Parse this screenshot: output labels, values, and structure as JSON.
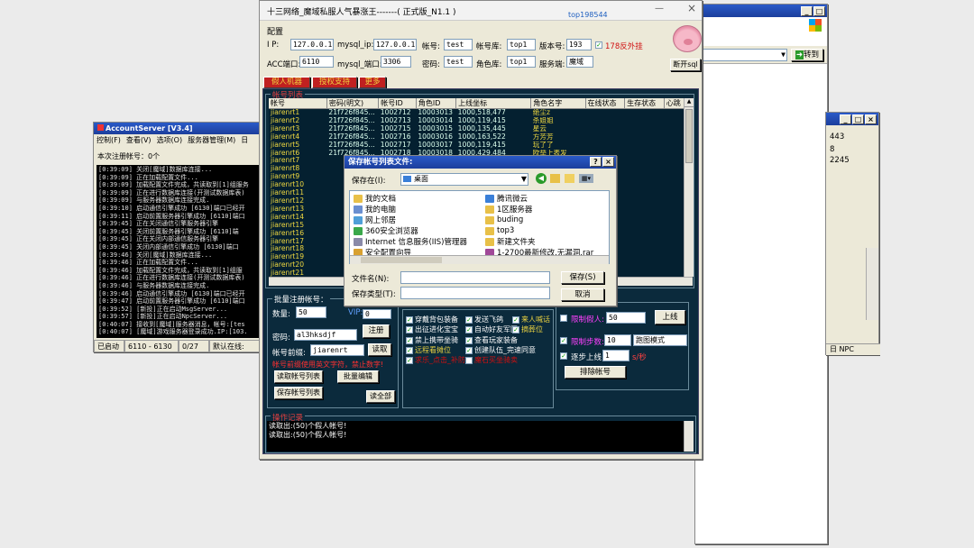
{
  "colors": {
    "desktop": "#ebebeb",
    "title_blue": "#1c3e9c",
    "dark_panel": "#0b2a3c",
    "gold": "#e8d040",
    "red": "#d01010",
    "cyan": "#5fd"
  },
  "account_server": {
    "title": "AccountServer [V3.4]",
    "menu": [
      "控制(F)",
      "查看(V)",
      "选项(O)",
      "服务器管理(M)",
      "日"
    ],
    "count": "本次注册帐号：0个",
    "log": [
      "[0:39:09] 关闭[魔域]数据库连接...",
      "[0:39:09] 正在加载配置文件...",
      "[0:39:09] 加载配置文件完成，共读取到[1]组服务",
      "[0:39:09] 正在进行数据库连接(开测试数据库表)",
      "[0:39:09] 与服务器数据库连接完成.",
      "[0:39:10] 启动通信引擎成功 [6130]端口已经开",
      "[0:39:11] 启动前置服务器引擎成功 [6110]端口",
      "[0:39:45] 正在关闭通信引擎服务器引擎",
      "[0:39:45] 关闭前置服务器引擎成功 [6110]端",
      "[0:39:45] 正在关闭内部通信服务器引擎",
      "[0:39:45] 关闭内部通信引擎成功 [6130]端口",
      "[0:39:46] 关闭[魔域]数据库连接...",
      "[0:39:46] 正在加载配置文件...",
      "[0:39:46] 加载配置文件完成，共读取到[1]组服",
      "[0:39:46] 正在进行数据库连接(开测试数据库表)",
      "[0:39:46] 与服务器数据库连接完成.",
      "[0:39:46] 启动通信引擎成功 [6130]端口已经开",
      "[0:39:47] 启动前置服务器引擎成功 [6110]端口",
      "[0:39:52] [新投]正在启动MsgServer...",
      "[0:39:57] [新投]正在启动NpcServer...",
      "[0:40:07] 接收到[魔域]服务器消息，帐号:[tes",
      "[0:40:07] [魔域]游戏服务器登录成功.IP:[103."
    ],
    "status": [
      "已启动",
      "6110 - 6130",
      "0/27",
      "默认在线:"
    ]
  },
  "right_window": {
    "address_arrow": "转到",
    "stats": [
      "443",
      "8",
      "2245"
    ],
    "npc": "日 NPC"
  },
  "main": {
    "title": "十三网络_魔域私服人气暴涨王-------( 正式版_N1.1 )",
    "watermark": "top198544",
    "config_title": "配置",
    "labels": {
      "ip": "I  P:",
      "mysql_ip": "mysql_ip:",
      "account": "帐号:",
      "account_db": "帐号库:",
      "version": "版本号:",
      "acc_port": "ACC端口:",
      "mysql_port": "mysql_端口:",
      "password": "密码:",
      "role_db": "角色库:",
      "server": "服务端:"
    },
    "values": {
      "ip": "127.0.0.1",
      "mysql_ip": "127.0.0.1",
      "account": "test",
      "account_db": "top1",
      "version": "193",
      "acc_port": "6110",
      "mysql_port": "3306",
      "password": "test",
      "role_db": "top1",
      "server": "魔域"
    },
    "anti_cheat": "178反外挂",
    "disconnect": "断开sql",
    "tabs": [
      "假人机器",
      "授权支持",
      "更多"
    ],
    "list_legend": "帐号列表",
    "columns": [
      "帐号",
      "密码(明文)",
      "帐号ID",
      "角色ID",
      "上线坐标",
      "角色名字",
      "在线状态",
      "生存状态",
      "心跳"
    ],
    "rows": [
      [
        "jiarenrt1",
        "21f726f845...",
        "1002712",
        "10003013",
        "1000,518,477",
        "绝尘z"
      ],
      [
        "jiarenrt2",
        "21f726f845...",
        "1002713",
        "10003014",
        "1000,119,415",
        "杀姐姐"
      ],
      [
        "jiarenrt3",
        "21f726f845...",
        "1002715",
        "10003015",
        "1000,135,445",
        "星云"
      ],
      [
        "jiarenrt4",
        "21f726f845...",
        "1002716",
        "10003016",
        "1000,163,522",
        "方芳芳"
      ],
      [
        "jiarenrt5",
        "21f726f845...",
        "1002717",
        "10003017",
        "1000,119,415",
        "玩了了"
      ],
      [
        "jiarenrt6",
        "21f726f845...",
        "1002718",
        "10003018",
        "1000,429,484",
        "欧举上表发"
      ],
      [
        "jiarenrt7",
        "",
        "",
        "",
        "",
        ""
      ],
      [
        "jiarenrt8",
        "",
        "",
        "",
        "",
        ""
      ],
      [
        "jiarenrt9",
        "",
        "",
        "",
        "",
        ""
      ],
      [
        "jiarenrt10",
        "",
        "",
        "",
        "",
        ""
      ],
      [
        "jiarenrt11",
        "",
        "",
        "",
        "",
        ""
      ],
      [
        "jiarenrt12",
        "",
        "",
        "",
        "",
        ""
      ],
      [
        "jiarenrt13",
        "",
        "",
        "",
        "",
        ""
      ],
      [
        "jiarenrt14",
        "",
        "",
        "",
        "",
        ""
      ],
      [
        "jiarenrt15",
        "",
        "",
        "",
        "",
        ""
      ],
      [
        "jiarenrt16",
        "",
        "",
        "",
        "",
        ""
      ],
      [
        "jiarenrt17",
        "",
        "",
        "",
        "",
        ""
      ],
      [
        "jiarenrt18",
        "",
        "",
        "",
        "",
        ""
      ],
      [
        "jiarenrt19",
        "",
        "",
        "",
        "",
        ""
      ],
      [
        "jiarenrt20",
        "",
        "",
        "",
        "",
        ""
      ],
      [
        "jiarenrt21",
        "",
        "",
        "",
        "",
        ""
      ]
    ],
    "batch": {
      "legend": "批量注册帐号：",
      "qty_label": "数量:",
      "qty": "50",
      "vip_label": "VIP:",
      "vip": "0",
      "pwd_label": "密码:",
      "pwd": "al3hksdjf",
      "register": "注册",
      "prefix_label": "帐号前缀:",
      "prefix": "jiarenrt",
      "read": "读取",
      "warn": "帐号前缀使用英文字符，禁止数字!",
      "read_list": "读取帐号列表",
      "batch_edit": "批量编辑",
      "save_list": "保存帐号列表",
      "read_all": "读全部"
    },
    "checks": [
      {
        "label": "穿戴背包装备",
        "c": "#ffffff",
        "on": true
      },
      {
        "label": "发送飞鸽",
        "c": "#ffffff",
        "on": true
      },
      {
        "label": "来人喊话",
        "c": "#e8d040",
        "on": true
      },
      {
        "label": "出征进化宝宝",
        "c": "#ffffff",
        "on": true
      },
      {
        "label": "自动好友军团",
        "c": "#ffffff",
        "on": true
      },
      {
        "label": "摘葬位",
        "c": "#e8d040",
        "on": true
      },
      {
        "label": "禁上携带坐骑",
        "c": "#ffffff",
        "on": true
      },
      {
        "label": "查看玩家装备",
        "c": "#ffffff",
        "on": true
      },
      {
        "label": "远程看摊位",
        "c": "#e8d040",
        "on": true
      },
      {
        "label": "创建队伍_完速同意",
        "c": "#ffffff",
        "on": true
      },
      {
        "label": "求乐_点击_补防",
        "c": "#d01010",
        "on": true
      },
      {
        "label": "魔石买坐骑卖",
        "c": "#d01010",
        "on": false
      }
    ],
    "limits": {
      "limit_fake": "限制假人:",
      "fake": "50",
      "online": "上线",
      "limit_steps": "限制步数:",
      "steps": "10",
      "mode": "跑图模式",
      "gradual": "逐步上线:",
      "gradual_val": "1",
      "per_sec": "s/秒",
      "kick": "排除帐号"
    },
    "log_legend": "操作记录",
    "log": [
      "读取出:(50)个假人帐号!",
      "读取出:(50)个假人帐号!"
    ]
  },
  "dialog": {
    "title": "保存帐号列表文件:",
    "save_in_label": "保存在(I):",
    "save_in": "桌面",
    "items_left": [
      {
        "name": "我的文档",
        "c": "#e8c048"
      },
      {
        "name": "我的电脑",
        "c": "#6a8fd0"
      },
      {
        "name": "网上邻居",
        "c": "#4f9fd8"
      },
      {
        "name": "360安全浏览器",
        "c": "#3aa84a"
      },
      {
        "name": "Internet 信息服务(IIS)管理器",
        "c": "#8a8aa8"
      },
      {
        "name": "安全配置向导",
        "c": "#d8a030"
      }
    ],
    "items_right": [
      {
        "name": "腾讯微云",
        "c": "#3a7fd8"
      },
      {
        "name": "1区服务器",
        "c": "#e8c048"
      },
      {
        "name": "buding",
        "c": "#e8c048"
      },
      {
        "name": "top3",
        "c": "#e8c048"
      },
      {
        "name": "新建文件夹",
        "c": "#e8c048"
      },
      {
        "name": "1-2700最新修改.无漏洞.rar",
        "c": "#a04898"
      }
    ],
    "filename_label": "文件名(N):",
    "filename": "",
    "filetype_label": "保存类型(T):",
    "filetype": "",
    "save": "保存(S)",
    "cancel": "取消"
  },
  "left_bottom_window": {
    "title": "",
    "stats": [
      "443",
      "8",
      "2245"
    ]
  }
}
